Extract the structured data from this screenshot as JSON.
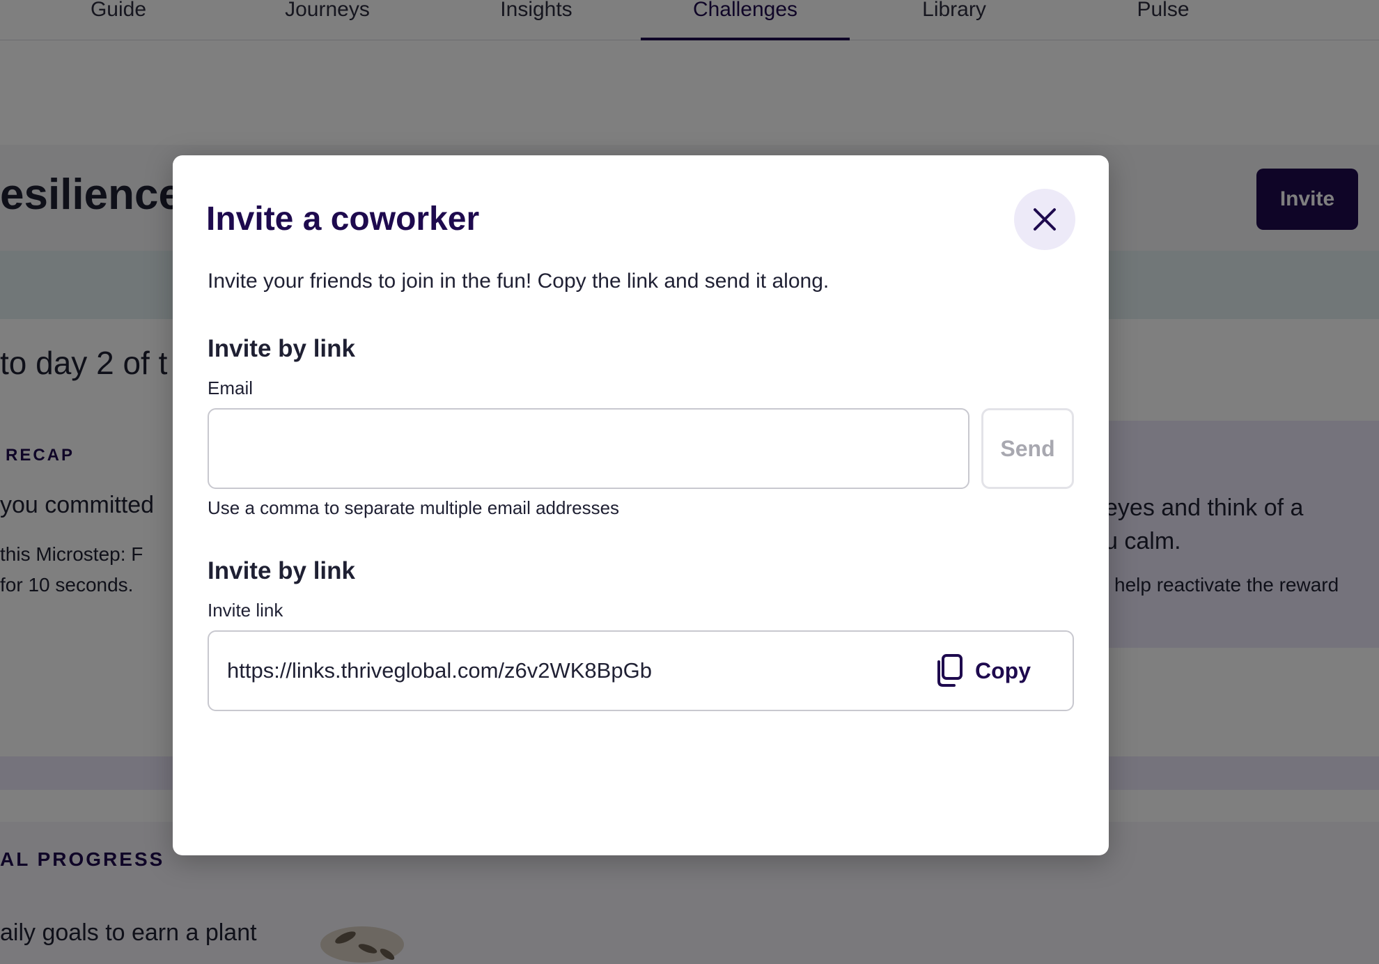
{
  "nav": {
    "tabs": [
      {
        "label": "Guide"
      },
      {
        "label": "Journeys"
      },
      {
        "label": "Insights"
      },
      {
        "label": "Challenges",
        "active": true
      },
      {
        "label": "Library"
      },
      {
        "label": "Pulse"
      }
    ]
  },
  "background": {
    "title_fragment": "esilience",
    "invite_button": "Invite",
    "day_fragment": "to day 2 of t",
    "recap_label": "RECAP",
    "recap_text_1": "you committed",
    "recap_text_2": "this Microstep: F",
    "recap_text_3": "for 10 seconds.",
    "right_text_1": "eyes and think of a",
    "right_text_2": "u calm.",
    "right_text_3": "help reactivate the reward",
    "progress_label": "AL PROGRESS",
    "progress_text": "aily goals to earn a plant"
  },
  "modal": {
    "title": "Invite a coworker",
    "description": "Invite your friends to join in the fun! Copy the link and send it along.",
    "email_section": {
      "heading": "Invite by link",
      "label": "Email",
      "value": "",
      "send_label": "Send",
      "helper": "Use a comma to separate multiple email addresses"
    },
    "link_section": {
      "heading": "Invite by link",
      "label": "Invite link",
      "url": "https://links.thriveglobal.com/z6v2WK8BpGb",
      "copy_label": "Copy"
    }
  },
  "icons": {
    "close": "close-icon",
    "copy": "copy-icon"
  },
  "colors": {
    "brand": "#1e0a4e",
    "close_bg": "#edeaf8",
    "lavender_card": "#ebe7f8"
  }
}
